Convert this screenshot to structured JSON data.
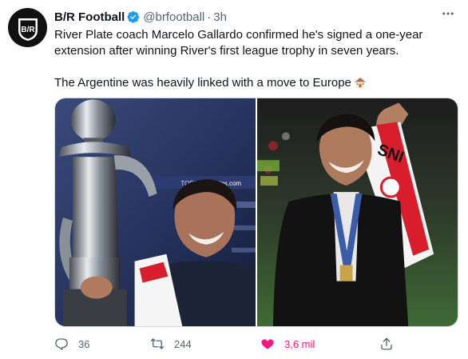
{
  "tweet": {
    "author_name": "B/R Football",
    "handle": "@brfootball",
    "separator": "·",
    "time": "3h",
    "paragraph1": "River Plate coach Marcelo Gallardo confirmed he's signed a one-year extension after winning River's first league trophy in seven years.",
    "paragraph2": "The Argentine was heavily linked with a move to Europe",
    "avatar_text": "B/R",
    "photo1_banner_text": "TORNEO",
    "photo1_banner_brand": "socios.com",
    "photo2_scarf_text": "SNI"
  },
  "actions": {
    "reply_count": "36",
    "retweet_count": "244",
    "like_count": "3,6 mil"
  },
  "colors": {
    "verified": "#1d9bf0",
    "like": "#f91880",
    "secondary_text": "#536471"
  },
  "icons": [
    "verified-badge-icon",
    "more-icon",
    "house-emoji-icon",
    "reply-icon",
    "retweet-icon",
    "heart-icon",
    "share-icon"
  ]
}
